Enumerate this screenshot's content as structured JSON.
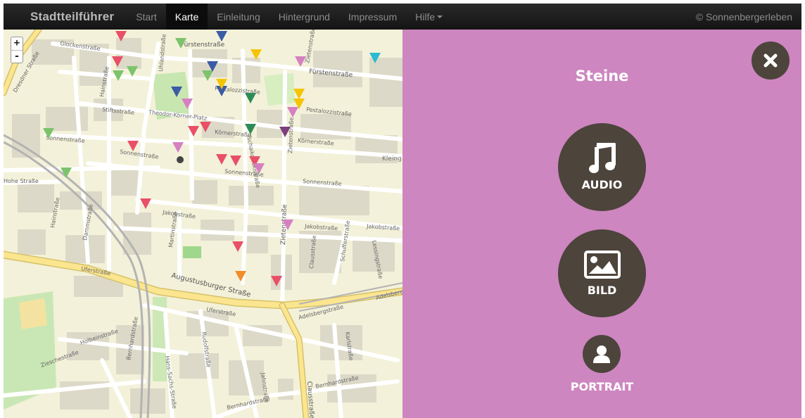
{
  "navbar": {
    "brand": "Stadtteilführer",
    "items": [
      {
        "label": "Start"
      },
      {
        "label": "Karte"
      },
      {
        "label": "Einleitung"
      },
      {
        "label": "Hintergrund"
      },
      {
        "label": "Impressum"
      },
      {
        "label": "Hilfe"
      }
    ],
    "copyright": "© Sonnenbergerleben"
  },
  "map": {
    "zoom_in": "+",
    "zoom_out": "-",
    "street_labels": [
      "Glockenstraße",
      "Fürstenstraße",
      "Fürstenstraße",
      "Uhlandstraße",
      "Hainstraße",
      "Stiftsstraße",
      "Theodor-Körner-Platz",
      "Körnerstraße",
      "Körnerstraße",
      "Pestalozzistraße",
      "Pestalozzistraße",
      "Sonnenstraße",
      "Sonnenstraße",
      "Sonnenstraße",
      "Sonnenstraße",
      "Zietenstraße",
      "Zietenstraße",
      "Zietenstraße",
      "Tschaikowskistraße",
      "Jakobstraße",
      "Jakobstraße",
      "Jakobstraße",
      "Martinstraße",
      "Dammstraße",
      "Hainstraße",
      "Uferstraße",
      "Uferstraße",
      "Augustusburger Straße",
      "Schufferstraße",
      "Lessingstraße",
      "Adelsbergstraße",
      "Adelsbergstraße",
      "Hohe Straße",
      "Holbeinstraße",
      "Zieschestraße",
      "Bernhardstraße",
      "Bernhardstraße",
      "Bernhardstraße",
      "Hans-Sachs-Straße",
      "Rudolfstraße",
      "Jahnstraße",
      "Clausstraße",
      "Clausstraße",
      "Karlstraße",
      "Kleing Ham",
      "Dresdner Straße"
    ],
    "markers": [
      {
        "color": "#e94f67"
      },
      {
        "color": "#e94f67"
      },
      {
        "color": "#e94f67"
      },
      {
        "color": "#e94f67"
      },
      {
        "color": "#e94f67"
      },
      {
        "color": "#e94f67"
      },
      {
        "color": "#e94f67"
      },
      {
        "color": "#e94f67"
      },
      {
        "color": "#e94f67"
      },
      {
        "color": "#e94f67"
      },
      {
        "color": "#e94f67"
      },
      {
        "color": "#7cc36b"
      },
      {
        "color": "#7cc36b"
      },
      {
        "color": "#7cc36b"
      },
      {
        "color": "#7cc36b"
      },
      {
        "color": "#7cc36b"
      },
      {
        "color": "#7cc36b"
      },
      {
        "color": "#3b5ba5"
      },
      {
        "color": "#3b5ba5"
      },
      {
        "color": "#3b5ba5"
      },
      {
        "color": "#3b5ba5"
      },
      {
        "color": "#f5c400"
      },
      {
        "color": "#f5c400"
      },
      {
        "color": "#f5c400"
      },
      {
        "color": "#f5c400"
      },
      {
        "color": "#d680c2"
      },
      {
        "color": "#d680c2"
      },
      {
        "color": "#d680c2"
      },
      {
        "color": "#d680c2"
      },
      {
        "color": "#d680c2"
      },
      {
        "color": "#d680c2"
      },
      {
        "color": "#2e8b57"
      },
      {
        "color": "#2e8b57"
      },
      {
        "color": "#7b3f7b"
      },
      {
        "color": "#f28c28"
      },
      {
        "color": "#2bbbd0"
      }
    ],
    "colors": {
      "background": "#f3f1d9",
      "building": "#dcd9c8",
      "road": "#ffffff",
      "main_road": "#fbe58f",
      "park": "#c8e6b0",
      "rail": "#b3b3b3"
    }
  },
  "panel": {
    "title": "Steine",
    "background": "#cd86bf",
    "buttons": [
      {
        "label": "AUDIO",
        "icon": "music-note-icon"
      },
      {
        "label": "BILD",
        "icon": "image-icon"
      },
      {
        "label": "PORTRAIT",
        "icon": "person-icon"
      }
    ],
    "close_icon": "close-icon"
  }
}
